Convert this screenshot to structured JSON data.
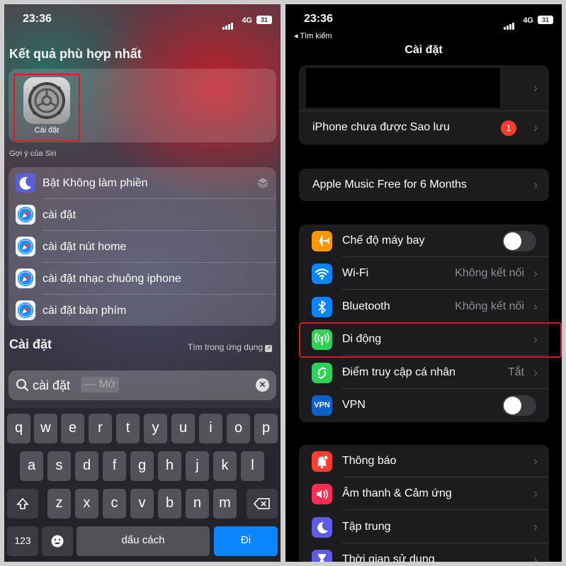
{
  "left": {
    "status": {
      "time": "23:36",
      "network": "4G",
      "battery": "31"
    },
    "best_match_header": "Kết quả phù hợp nhất",
    "best_app_label": "Cài đặt",
    "siri_header": "Gợi ý của Siri",
    "suggestions": [
      {
        "label": "Bật Không làm phiền",
        "icon": "moon-icon"
      },
      {
        "label": "cài đặt",
        "icon": "safari-icon"
      },
      {
        "label": "cài đặt nút home",
        "icon": "safari-icon"
      },
      {
        "label": "cài đặt nhạc chuông iphone",
        "icon": "safari-icon"
      },
      {
        "label": "cài đặt bàn phím",
        "icon": "safari-icon"
      }
    ],
    "section_title": "Cài đặt",
    "section_link": "Tìm trong ứng dụng",
    "search": {
      "query": "cài đặt",
      "suffix_hint": "— Mở"
    },
    "keyboard": {
      "row1": [
        "q",
        "w",
        "e",
        "r",
        "t",
        "y",
        "u",
        "i",
        "o",
        "p"
      ],
      "row2": [
        "a",
        "s",
        "d",
        "f",
        "g",
        "h",
        "j",
        "k",
        "l"
      ],
      "row3": [
        "z",
        "x",
        "c",
        "v",
        "b",
        "n",
        "m"
      ],
      "numbers_key": "123",
      "space_key": "dấu cách",
      "go_key": "Đi"
    }
  },
  "right": {
    "status": {
      "time": "23:36",
      "network": "4G",
      "battery": "31",
      "back_label": "◂ Tìm kiếm"
    },
    "title": "Cài đặt",
    "backup_row": {
      "label": "iPhone chưa được Sao lưu",
      "badge": "1"
    },
    "promo_row": {
      "label": "Apple Music Free for 6 Months"
    },
    "network_rows": [
      {
        "label": "Chế độ máy bay",
        "value": "",
        "color": "#ff9500",
        "icon": "airplane-icon"
      },
      {
        "label": "Wi-Fi",
        "value": "Không kết nối",
        "color": "#0a84ff",
        "icon": "wifi-icon"
      },
      {
        "label": "Bluetooth",
        "value": "Không kết nối",
        "color": "#0a84ff",
        "icon": "bluetooth-icon"
      },
      {
        "label": "Di động",
        "value": "",
        "color": "#30d158",
        "icon": "antenna-icon"
      },
      {
        "label": "Điểm truy cập cá nhân",
        "value": "Tắt",
        "color": "#30d158",
        "icon": "hotspot-icon"
      },
      {
        "label": "VPN",
        "value": "",
        "color": "#0a62c9",
        "icon": "vpn-icon",
        "icon_text": "VPN"
      }
    ],
    "notify_rows": [
      {
        "label": "Thông báo",
        "color": "#ff3b30",
        "icon": "bell-icon"
      },
      {
        "label": "Âm thanh & Cảm ứng",
        "color": "#ff2d55",
        "icon": "speaker-icon"
      },
      {
        "label": "Tập trung",
        "color": "#5e5ce6",
        "icon": "moon-icon"
      },
      {
        "label": "Thời gian sử dụng",
        "color": "#5e5ce6",
        "icon": "hourglass-icon"
      }
    ]
  }
}
